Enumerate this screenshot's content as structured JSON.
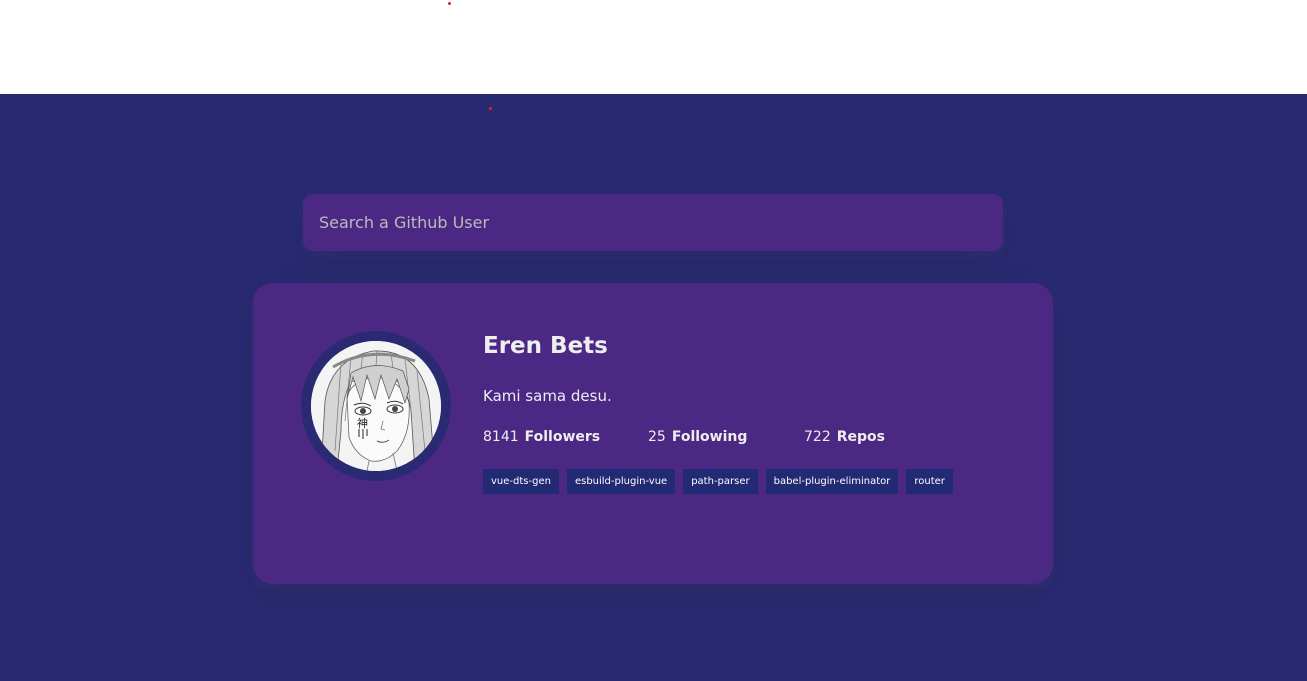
{
  "search": {
    "placeholder": "Search a Github User"
  },
  "profile": {
    "name": "Eren Bets",
    "bio": "Kami sama desu.",
    "avatar_icon": "anime-portrait-avatar",
    "stats": [
      {
        "value": "8141",
        "label": "Followers"
      },
      {
        "value": "25",
        "label": "Following"
      },
      {
        "value": "722",
        "label": "Repos"
      }
    ],
    "repos": [
      "vue-dts-gen",
      "esbuild-plugin-vue",
      "path-parser",
      "babel-plugin-eliminator",
      "router"
    ]
  },
  "colors": {
    "background": "#2a2a72",
    "card": "#4c2885",
    "repo_tag": "#212a72",
    "text": "#eeeeee"
  }
}
